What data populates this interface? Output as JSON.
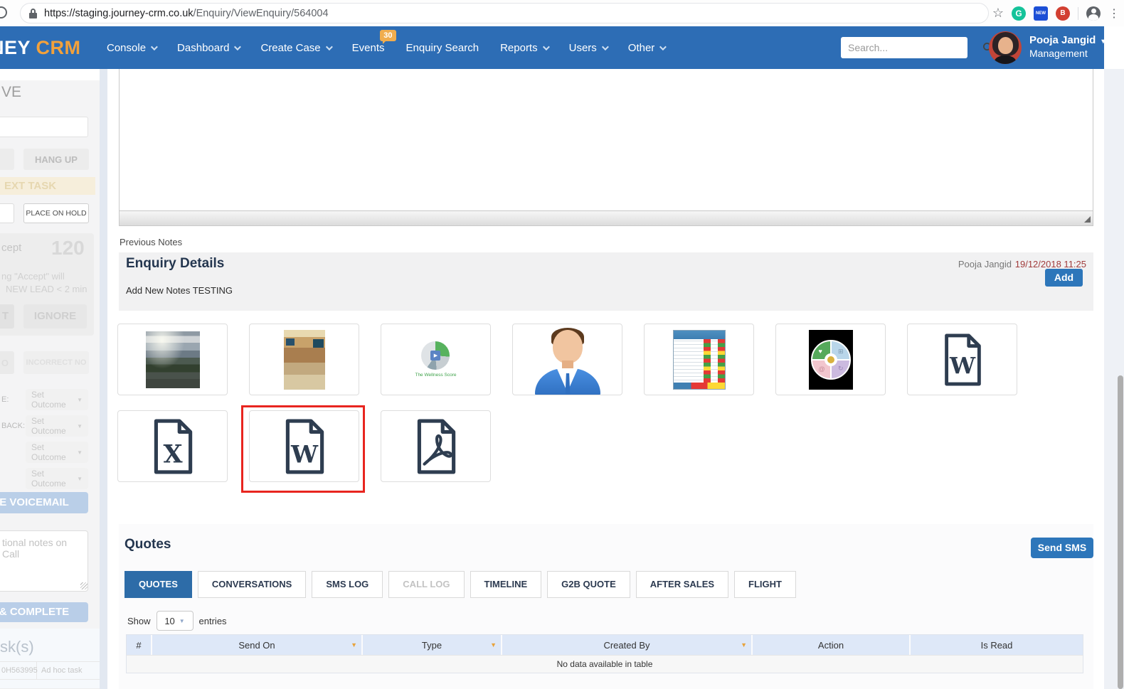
{
  "browser": {
    "url_domain": "https://staging.journey-crm.co.uk",
    "url_path": "/Enquiry/ViewEnquiry/564004",
    "extension_new_label": "NEW",
    "extension_grammarly_label": "G",
    "extension_red_label": "B"
  },
  "navbar": {
    "logo_partial": "NEY",
    "logo_accent": "CRM",
    "items": [
      {
        "label": "Console",
        "caret": true
      },
      {
        "label": "Dashboard",
        "caret": true
      },
      {
        "label": "Create Case",
        "caret": true
      },
      {
        "label": "Events",
        "caret": false
      },
      {
        "label": "Enquiry Search",
        "caret": false
      },
      {
        "label": "Reports",
        "caret": true
      },
      {
        "label": "Users",
        "caret": true
      },
      {
        "label": "Other",
        "caret": true
      }
    ],
    "events_badge": "30",
    "search_placeholder": "Search...",
    "user_name": "Pooja Jangid",
    "user_role": "Management"
  },
  "sidebar": {
    "heading_partial": "VE",
    "hang_up": "HANG UP",
    "next_task_partial": "EXT TASK",
    "place_on_hold": "PLACE ON HOLD",
    "accept_partial": "cept",
    "countdown": "120",
    "accept_note_line1": "ng \"Accept\" will",
    "accept_note_line2": "NEW LEAD < 2 min",
    "cut_letter_t": "T",
    "ignore": "IGNORE",
    "cut_letter_o": "O",
    "incorrect_no": "INCORRECT NO",
    "label_e": "E:",
    "label_back": "BACK:",
    "set_outcome": "Set Outcome",
    "voicemail_partial": "E VOICEMAIL",
    "notes_placeholder": "tional notes on Call",
    "complete_partial": "& COMPLETE",
    "tasks_heading_partial": "sk(s)",
    "task_id_partial": "0H563995",
    "task_type": "Ad hoc task"
  },
  "notes": {
    "previous_notes_label": "Previous Notes",
    "panel_title": "Enquiry Details",
    "panel_subtitle": "Add New Notes TESTING",
    "author": "Pooja Jangid",
    "timestamp": "19/12/2018 11:25",
    "add_button": "Add"
  },
  "attachments": {
    "wellness_caption": "The Wellness Score",
    "doc_letter_word": "W",
    "doc_letter_excel": "X",
    "items_row1": [
      "landscape-photo",
      "interior-photo",
      "wellness-logo",
      "person-avatar",
      "spreadsheet-screenshot",
      "puzzle-wheel-graphic",
      "word-document"
    ],
    "items_row2": [
      "excel-document",
      "word-document-selected",
      "pdf-document"
    ]
  },
  "quotes": {
    "title": "Quotes",
    "send_sms_button": "Send SMS",
    "tabs": [
      {
        "label": "QUOTES",
        "state": "active"
      },
      {
        "label": "CONVERSATIONS",
        "state": "normal"
      },
      {
        "label": "SMS LOG",
        "state": "normal"
      },
      {
        "label": "CALL LOG",
        "state": "disabled"
      },
      {
        "label": "TIMELINE",
        "state": "normal"
      },
      {
        "label": "G2B QUOTE",
        "state": "normal"
      },
      {
        "label": "AFTER SALES",
        "state": "normal"
      },
      {
        "label": "FLIGHT",
        "state": "normal"
      }
    ],
    "show_label": "Show",
    "page_size": "10",
    "entries_label": "entries",
    "table": {
      "headers": [
        "#",
        "Send On",
        "Type",
        "Created By",
        "Action",
        "Is Read"
      ],
      "empty_message": "No data available in table"
    }
  },
  "colors": {
    "navbar_blue": "#2d6db5",
    "accent_orange": "#f2a13b",
    "button_blue": "#2d76ba",
    "highlight_red": "#e8251f",
    "timestamp_red": "#a13c3c"
  }
}
